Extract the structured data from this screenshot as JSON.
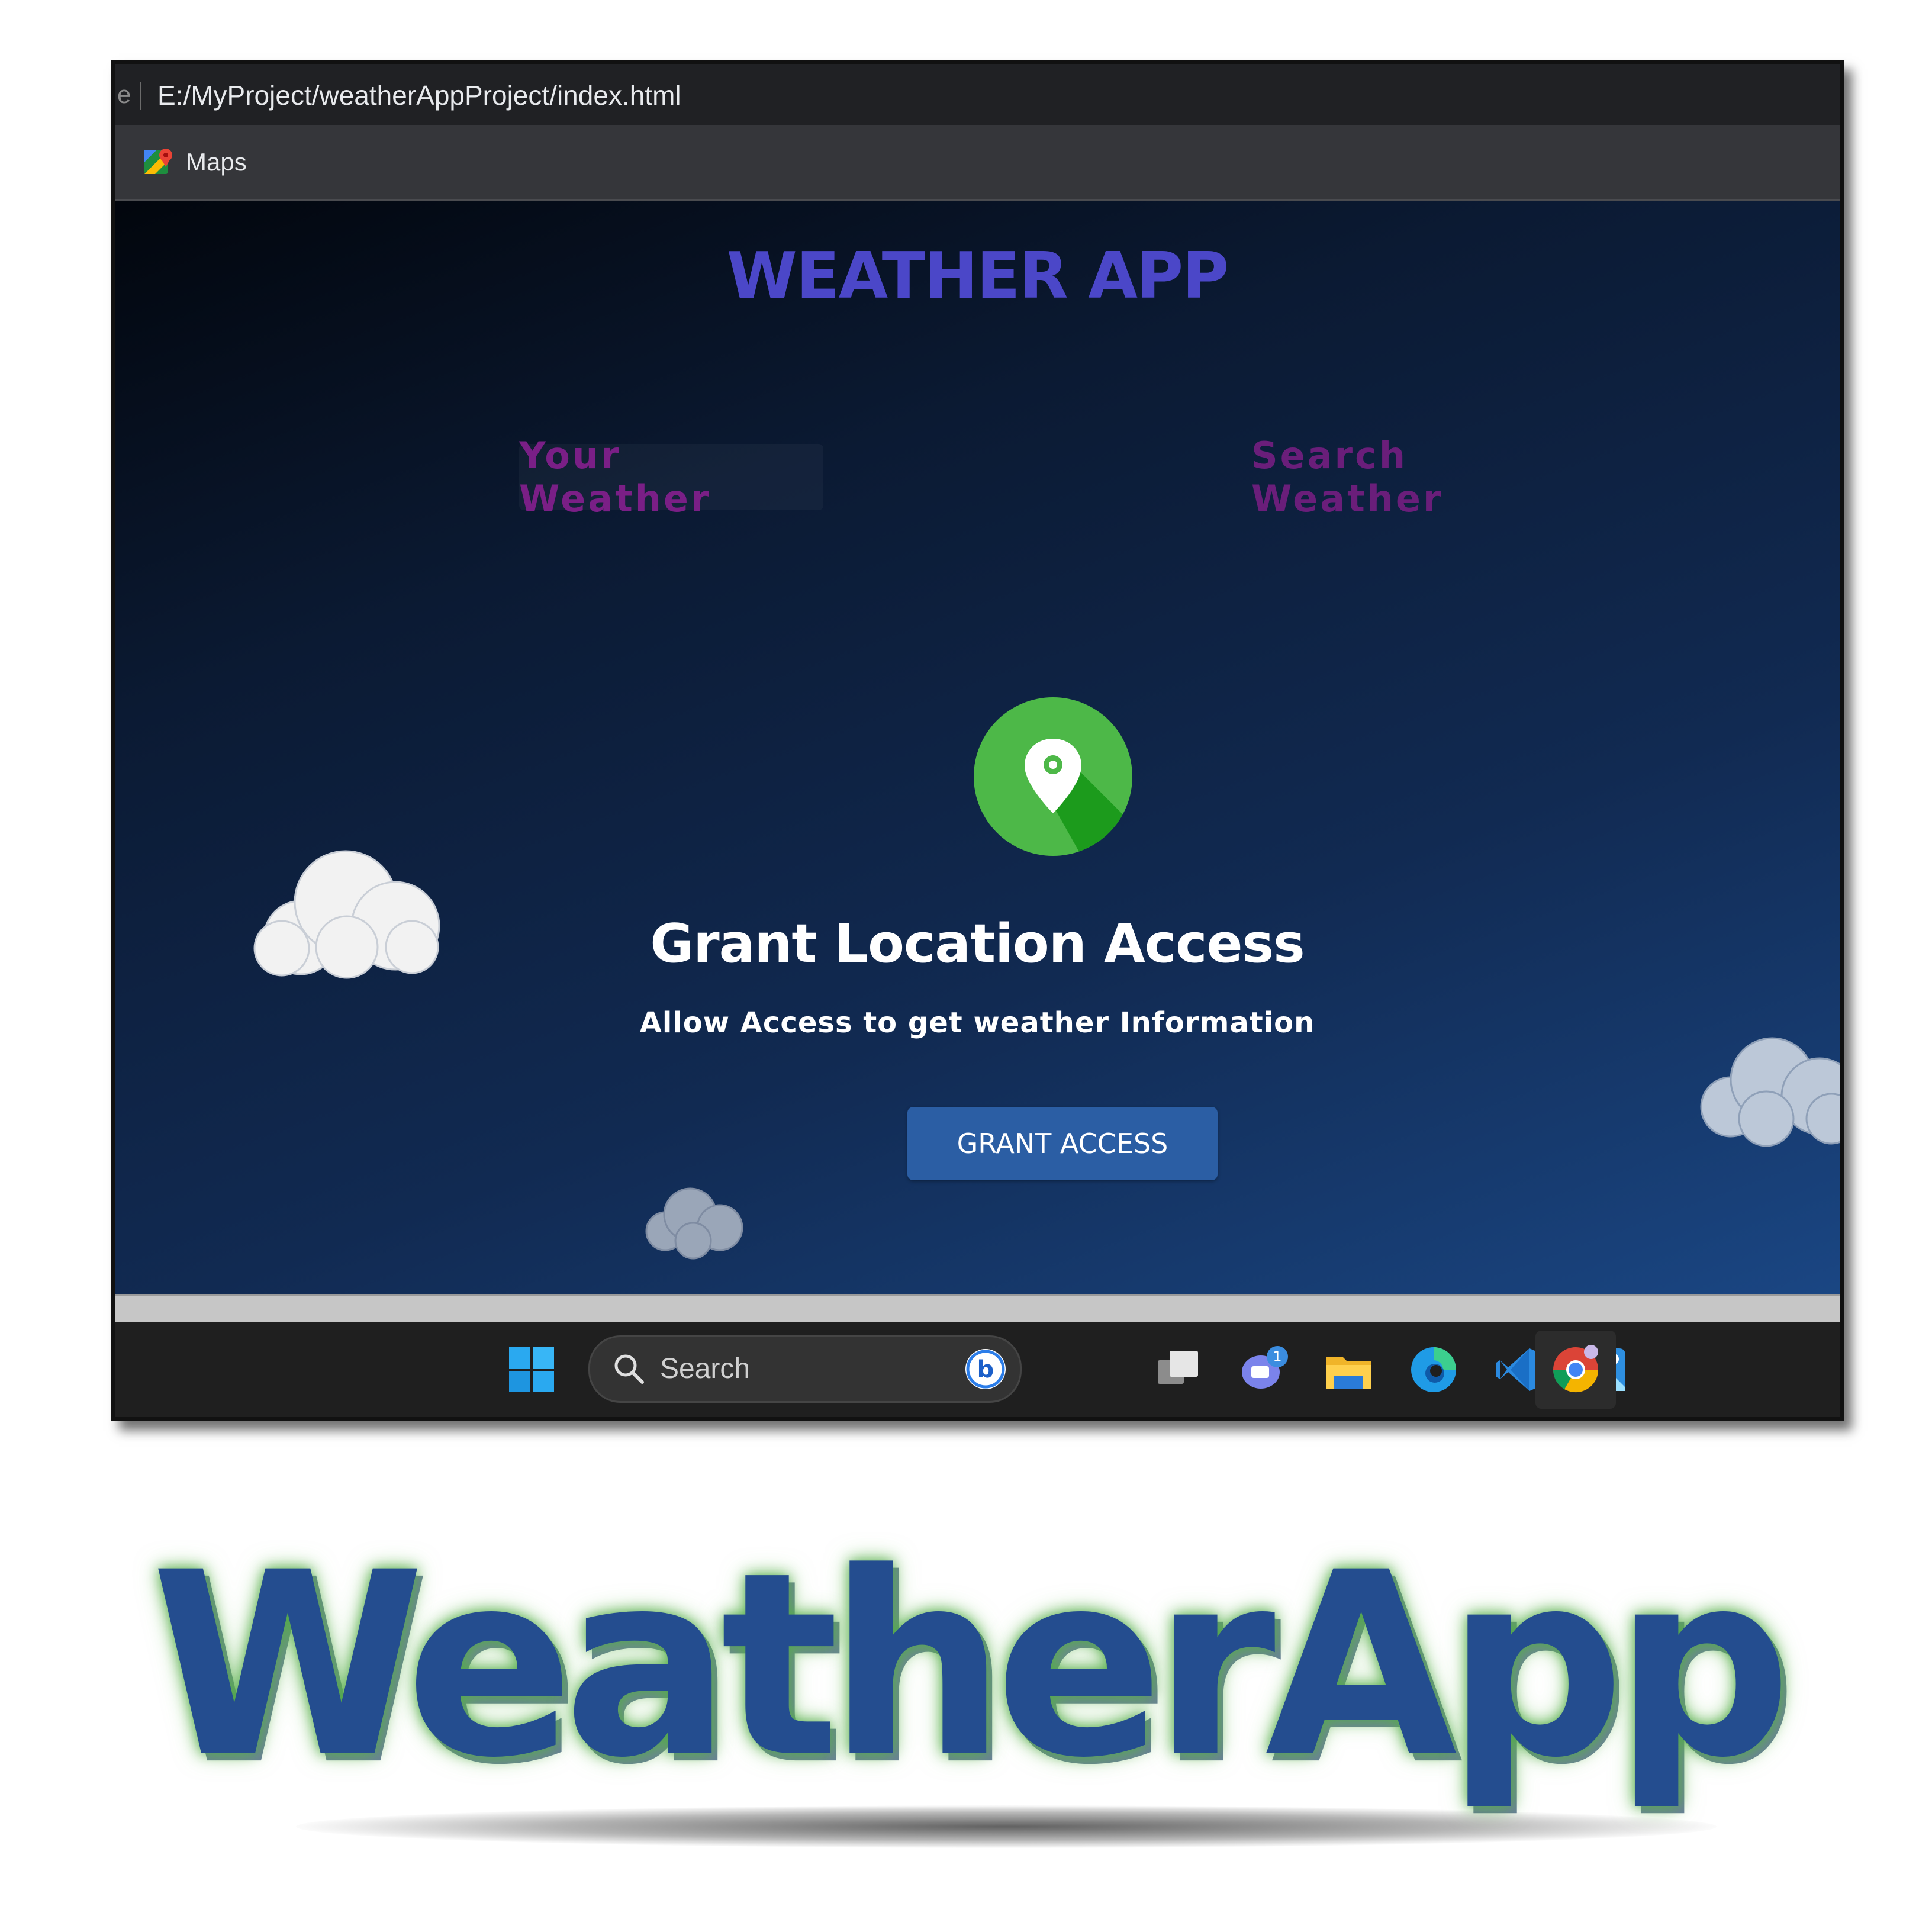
{
  "browser": {
    "address_stub": "e",
    "url": "E:/MyProject/weatherAppProject/index.html",
    "bookmarks": [
      {
        "label": "Maps",
        "icon": "google-maps-icon"
      }
    ]
  },
  "app": {
    "title": "WEATHER APP",
    "tabs": [
      {
        "label": "Your Weather",
        "active": true
      },
      {
        "label": "Search Weather",
        "active": false
      }
    ],
    "location_icon": "location-pin-icon",
    "grant_title": "Grant Location Access",
    "grant_subtitle": "Allow Access to get weather Information",
    "grant_button": "GRANT ACCESS"
  },
  "taskbar": {
    "search_placeholder": "Search",
    "icons": [
      "windows-start-icon",
      "search-icon",
      "bing-icon",
      "task-view-icon",
      "teams-chat-icon",
      "file-explorer-icon",
      "edge-icon",
      "vscode-icon",
      "photos-icon",
      "chrome-icon"
    ],
    "chat_badge": "1"
  },
  "logo": {
    "text": "WeatherApp"
  },
  "colors": {
    "app_title": "#4b47c8",
    "tab_text": "#7a1f86",
    "button": "#2b5ea4",
    "pin_green": "#4db848",
    "logo_fill": "#244d8f",
    "logo_glow": "#5fb04a"
  }
}
